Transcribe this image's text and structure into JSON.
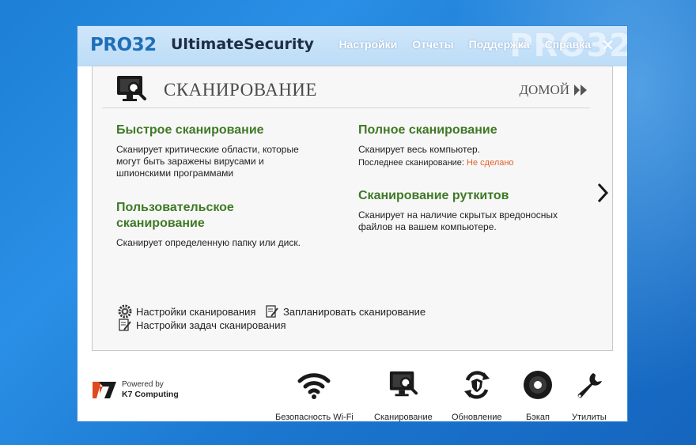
{
  "app": {
    "logo_prefix": "PRO32",
    "logo_name": "UltimateSecurity",
    "watermark": "PRO32"
  },
  "topnav": {
    "settings": "Настройки",
    "reports": "Отчеты",
    "support": "Поддержка",
    "help": "Справка"
  },
  "panel": {
    "title": "СКАНИРОВАНИЕ",
    "home_label": "ДОМОЙ"
  },
  "options": {
    "quick": {
      "title": "Быстрое сканирование",
      "desc": "Сканирует критические области, которые могут быть заражены вирусами и шпионскими программами"
    },
    "full": {
      "title": "Полное сканирование",
      "desc": "Сканирует весь компьютер.",
      "last_label": "Последнее сканирование:",
      "last_value": "Не сделано"
    },
    "custom": {
      "title": "Пользовательское сканирование",
      "desc": "Сканирует определенную папку или диск."
    },
    "rootkit": {
      "title": "Сканирование руткитов",
      "desc": "Сканирует на наличие скрытых вредоносных файлов на вашем компьютере."
    }
  },
  "links": {
    "scan_settings": "Настройки сканирования",
    "schedule": "Запланировать сканирование",
    "task_settings": "Настройки задач сканирования"
  },
  "footer": {
    "powered_by": "Powered by",
    "company": "K7 Computing",
    "tools": {
      "wifi": "Безопасность Wi-Fi",
      "scan": "Сканирование",
      "update": "Обновление",
      "backup": "Бэкап",
      "utilities": "Утилиты"
    }
  },
  "colors": {
    "accent_green": "#3e7a26",
    "status_orange": "#e0622a",
    "header_blue": "#cfe6fa",
    "logo_blue": "#1f6fb8",
    "desktop_blue": "#1d7fd6"
  },
  "icons": {
    "close": "close-icon",
    "scan": "monitor-search-icon",
    "home": "double-chevron-right-icon",
    "next": "chevron-right-icon",
    "scan_settings": "gear-icon",
    "schedule": "notepad-pencil-icon",
    "task_settings": "notepad-pencil-icon",
    "wifi": "wifi-icon",
    "update": "refresh-shield-icon",
    "backup": "disc-icon",
    "utilities": "wrench-icon"
  }
}
